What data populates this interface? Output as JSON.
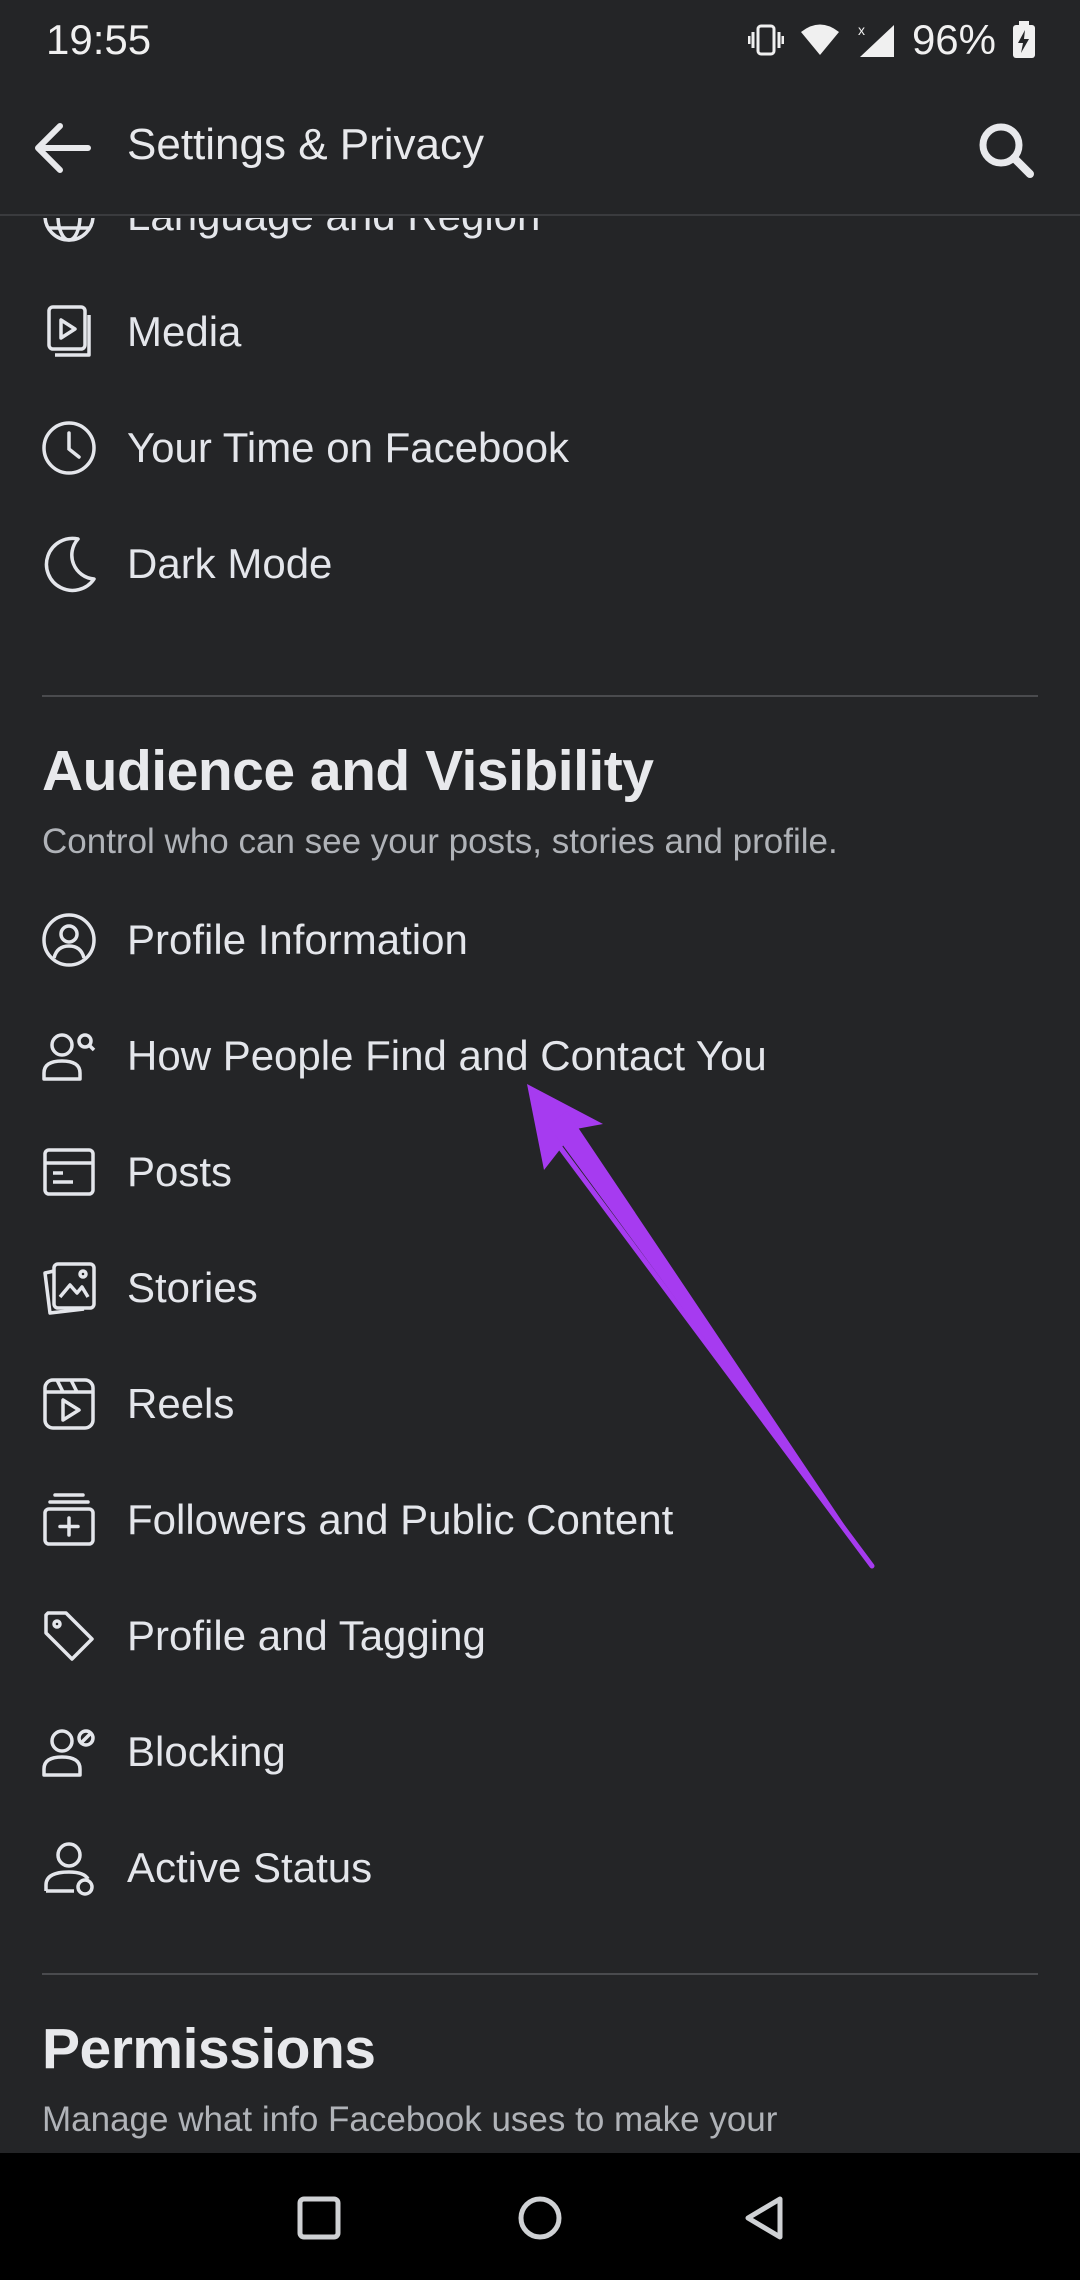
{
  "status_bar": {
    "time": "19:55",
    "battery": "96%",
    "icons": [
      "vibrate-icon",
      "wifi-icon",
      "signal-icon",
      "battery-charging-icon"
    ]
  },
  "header": {
    "title": "Settings & Privacy",
    "back_icon": "arrow-left-icon",
    "search_icon": "search-icon"
  },
  "preferences_items": [
    {
      "label": "Language and Region",
      "icon": "globe-icon"
    },
    {
      "label": "Media",
      "icon": "media-icon"
    },
    {
      "label": "Your Time on Facebook",
      "icon": "clock-icon"
    },
    {
      "label": "Dark Mode",
      "icon": "moon-icon"
    }
  ],
  "audience": {
    "title": "Audience and Visibility",
    "subtitle": "Control who can see your posts, stories and profile.",
    "items": [
      {
        "label": "Profile Information",
        "icon": "profile-circle-icon"
      },
      {
        "label": "How People Find and Contact You",
        "icon": "people-contact-icon"
      },
      {
        "label": "Posts",
        "icon": "posts-icon"
      },
      {
        "label": "Stories",
        "icon": "stories-icon"
      },
      {
        "label": "Reels",
        "icon": "reels-icon"
      },
      {
        "label": "Followers and Public Content",
        "icon": "followers-icon"
      },
      {
        "label": "Profile and Tagging",
        "icon": "tag-icon"
      },
      {
        "label": "Blocking",
        "icon": "blocking-icon"
      },
      {
        "label": "Active Status",
        "icon": "active-status-icon"
      }
    ]
  },
  "permissions": {
    "title": "Permissions",
    "subtitle": "Manage what info Facebook uses to make your"
  },
  "annotation": {
    "arrow_color": "#a63bf0"
  },
  "nav_bar": {
    "icons": [
      "recents-square-icon",
      "home-circle-icon",
      "back-triangle-icon"
    ]
  },
  "colors": {
    "background": "#242527",
    "text": "#e4e6eb",
    "subtext": "#b0b3b8"
  }
}
